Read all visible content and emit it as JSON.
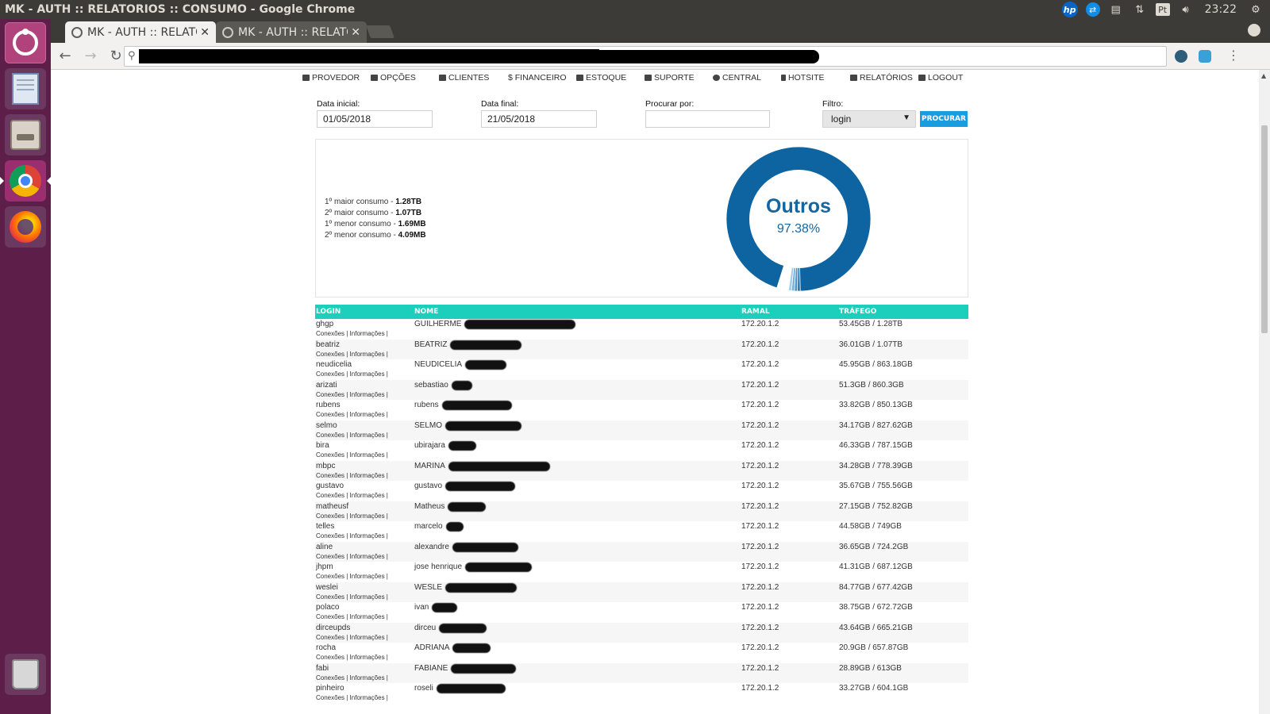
{
  "os": {
    "window_title": "MK - AUTH :: RELATORIOS :: CONSUMO - Google Chrome",
    "clock": "23:22",
    "tray": {
      "hp": "hp",
      "pt": "Pt"
    }
  },
  "browser": {
    "tabs": [
      {
        "title": "MK - AUTH :: RELATO",
        "active": true,
        "close": "✕"
      },
      {
        "title": "MK - AUTH :: RELATO",
        "active": false,
        "close": "✕"
      }
    ],
    "back": "←",
    "forward": "→",
    "reload": "↻",
    "menu": "⋮"
  },
  "nav": {
    "items": [
      "PROVEDOR",
      "OPÇÕES",
      "CLIENTES",
      "$ FINANCEIRO",
      "ESTOQUE",
      "SUPORTE",
      "CENTRAL",
      "HOTSITE",
      "RELATÓRIOS",
      "LOGOUT"
    ]
  },
  "filters": {
    "start_label": "Data inicial:",
    "start_value": "01/05/2018",
    "end_label": "Data final:",
    "end_value": "21/05/2018",
    "search_label": "Procurar por:",
    "search_value": "",
    "filter_label": "Filtro:",
    "filter_value": "login",
    "button": "PROCURAR"
  },
  "summary": {
    "items": [
      {
        "label": "1º maior consumo - ",
        "value": "1.28TB"
      },
      {
        "label": "2º maior consumo - ",
        "value": "1.07TB"
      },
      {
        "label": "1º menor consumo - ",
        "value": "1.69MB"
      },
      {
        "label": "2º menor consumo - ",
        "value": "4.09MB"
      }
    ],
    "donut_label": "Outros",
    "donut_percent": "97.38%",
    "donut_main_fraction": 0.9738,
    "main_color": "#0d64a0",
    "slice_colors": [
      "#2a7ab3",
      "#4d93c4",
      "#7db0d6",
      "#a9cbe6"
    ]
  },
  "table": {
    "headers": [
      "LOGIN",
      "NOME",
      "RAMAL",
      "TRÁFEGO"
    ],
    "action_links": "Conexões | Informações |",
    "header_color": "#1ccfbc",
    "rows": [
      {
        "login": "ghgp",
        "nome": "GUILHERME",
        "ramal": "172.20.1.2",
        "trafego": "53.45GB / 1.28TB"
      },
      {
        "login": "beatriz",
        "nome": "BEATRIZ",
        "ramal": "172.20.1.2",
        "trafego": "36.01GB / 1.07TB"
      },
      {
        "login": "neudicelia",
        "nome": "NEUDICELIA",
        "ramal": "172.20.1.2",
        "trafego": "45.95GB / 863.18GB"
      },
      {
        "login": "arizati",
        "nome": "sebastiao",
        "ramal": "172.20.1.2",
        "trafego": "51.3GB / 860.3GB"
      },
      {
        "login": "rubens",
        "nome": "rubens",
        "ramal": "172.20.1.2",
        "trafego": "33.82GB / 850.13GB"
      },
      {
        "login": "selmo",
        "nome": "SELMO",
        "ramal": "172.20.1.2",
        "trafego": "34.17GB / 827.62GB"
      },
      {
        "login": "bira",
        "nome": "ubirajara",
        "ramal": "172.20.1.2",
        "trafego": "46.33GB / 787.15GB"
      },
      {
        "login": "mbpc",
        "nome": "MARINA",
        "ramal": "172.20.1.2",
        "trafego": "34.28GB / 778.39GB"
      },
      {
        "login": "gustavo",
        "nome": "gustavo",
        "ramal": "172.20.1.2",
        "trafego": "35.67GB / 755.56GB"
      },
      {
        "login": "matheusf",
        "nome": "Matheus",
        "ramal": "172.20.1.2",
        "trafego": "27.15GB / 752.82GB"
      },
      {
        "login": "telles",
        "nome": "marcelo",
        "ramal": "172.20.1.2",
        "trafego": "44.58GB / 749GB"
      },
      {
        "login": "aline",
        "nome": "alexandre",
        "ramal": "172.20.1.2",
        "trafego": "36.65GB / 724.2GB"
      },
      {
        "login": "jhpm",
        "nome": "jose henrique",
        "ramal": "172.20.1.2",
        "trafego": "41.31GB / 687.12GB"
      },
      {
        "login": "weslei",
        "nome": "WESLE",
        "ramal": "172.20.1.2",
        "trafego": "84.77GB / 677.42GB"
      },
      {
        "login": "polaco",
        "nome": "ivan",
        "ramal": "172.20.1.2",
        "trafego": "38.75GB / 672.72GB"
      },
      {
        "login": "dirceupds",
        "nome": "dirceu",
        "ramal": "172.20.1.2",
        "trafego": "43.64GB / 665.21GB"
      },
      {
        "login": "rocha",
        "nome": "ADRIANA",
        "ramal": "172.20.1.2",
        "trafego": "20.9GB / 657.87GB"
      },
      {
        "login": "fabi",
        "nome": "FABIANE",
        "ramal": "172.20.1.2",
        "trafego": "28.89GB / 613GB"
      },
      {
        "login": "pinheiro",
        "nome": "roseli",
        "ramal": "172.20.1.2",
        "trafego": "33.27GB / 604.1GB"
      }
    ]
  }
}
